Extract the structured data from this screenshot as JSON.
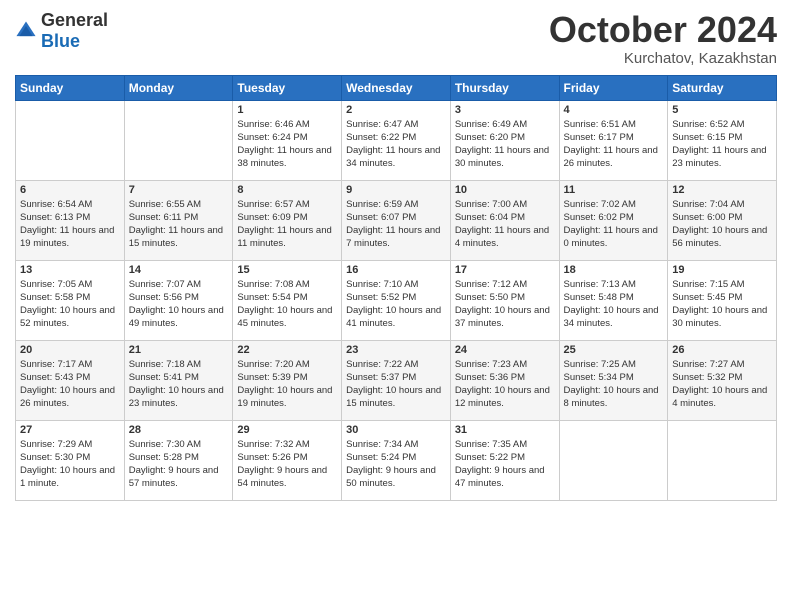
{
  "logo": {
    "general": "General",
    "blue": "Blue"
  },
  "title": {
    "month": "October 2024",
    "location": "Kurchatov, Kazakhstan"
  },
  "headers": [
    "Sunday",
    "Monday",
    "Tuesday",
    "Wednesday",
    "Thursday",
    "Friday",
    "Saturday"
  ],
  "weeks": [
    [
      {
        "day": "",
        "sunrise": "",
        "sunset": "",
        "daylight": ""
      },
      {
        "day": "",
        "sunrise": "",
        "sunset": "",
        "daylight": ""
      },
      {
        "day": "1",
        "sunrise": "Sunrise: 6:46 AM",
        "sunset": "Sunset: 6:24 PM",
        "daylight": "Daylight: 11 hours and 38 minutes."
      },
      {
        "day": "2",
        "sunrise": "Sunrise: 6:47 AM",
        "sunset": "Sunset: 6:22 PM",
        "daylight": "Daylight: 11 hours and 34 minutes."
      },
      {
        "day": "3",
        "sunrise": "Sunrise: 6:49 AM",
        "sunset": "Sunset: 6:20 PM",
        "daylight": "Daylight: 11 hours and 30 minutes."
      },
      {
        "day": "4",
        "sunrise": "Sunrise: 6:51 AM",
        "sunset": "Sunset: 6:17 PM",
        "daylight": "Daylight: 11 hours and 26 minutes."
      },
      {
        "day": "5",
        "sunrise": "Sunrise: 6:52 AM",
        "sunset": "Sunset: 6:15 PM",
        "daylight": "Daylight: 11 hours and 23 minutes."
      }
    ],
    [
      {
        "day": "6",
        "sunrise": "Sunrise: 6:54 AM",
        "sunset": "Sunset: 6:13 PM",
        "daylight": "Daylight: 11 hours and 19 minutes."
      },
      {
        "day": "7",
        "sunrise": "Sunrise: 6:55 AM",
        "sunset": "Sunset: 6:11 PM",
        "daylight": "Daylight: 11 hours and 15 minutes."
      },
      {
        "day": "8",
        "sunrise": "Sunrise: 6:57 AM",
        "sunset": "Sunset: 6:09 PM",
        "daylight": "Daylight: 11 hours and 11 minutes."
      },
      {
        "day": "9",
        "sunrise": "Sunrise: 6:59 AM",
        "sunset": "Sunset: 6:07 PM",
        "daylight": "Daylight: 11 hours and 7 minutes."
      },
      {
        "day": "10",
        "sunrise": "Sunrise: 7:00 AM",
        "sunset": "Sunset: 6:04 PM",
        "daylight": "Daylight: 11 hours and 4 minutes."
      },
      {
        "day": "11",
        "sunrise": "Sunrise: 7:02 AM",
        "sunset": "Sunset: 6:02 PM",
        "daylight": "Daylight: 11 hours and 0 minutes."
      },
      {
        "day": "12",
        "sunrise": "Sunrise: 7:04 AM",
        "sunset": "Sunset: 6:00 PM",
        "daylight": "Daylight: 10 hours and 56 minutes."
      }
    ],
    [
      {
        "day": "13",
        "sunrise": "Sunrise: 7:05 AM",
        "sunset": "Sunset: 5:58 PM",
        "daylight": "Daylight: 10 hours and 52 minutes."
      },
      {
        "day": "14",
        "sunrise": "Sunrise: 7:07 AM",
        "sunset": "Sunset: 5:56 PM",
        "daylight": "Daylight: 10 hours and 49 minutes."
      },
      {
        "day": "15",
        "sunrise": "Sunrise: 7:08 AM",
        "sunset": "Sunset: 5:54 PM",
        "daylight": "Daylight: 10 hours and 45 minutes."
      },
      {
        "day": "16",
        "sunrise": "Sunrise: 7:10 AM",
        "sunset": "Sunset: 5:52 PM",
        "daylight": "Daylight: 10 hours and 41 minutes."
      },
      {
        "day": "17",
        "sunrise": "Sunrise: 7:12 AM",
        "sunset": "Sunset: 5:50 PM",
        "daylight": "Daylight: 10 hours and 37 minutes."
      },
      {
        "day": "18",
        "sunrise": "Sunrise: 7:13 AM",
        "sunset": "Sunset: 5:48 PM",
        "daylight": "Daylight: 10 hours and 34 minutes."
      },
      {
        "day": "19",
        "sunrise": "Sunrise: 7:15 AM",
        "sunset": "Sunset: 5:45 PM",
        "daylight": "Daylight: 10 hours and 30 minutes."
      }
    ],
    [
      {
        "day": "20",
        "sunrise": "Sunrise: 7:17 AM",
        "sunset": "Sunset: 5:43 PM",
        "daylight": "Daylight: 10 hours and 26 minutes."
      },
      {
        "day": "21",
        "sunrise": "Sunrise: 7:18 AM",
        "sunset": "Sunset: 5:41 PM",
        "daylight": "Daylight: 10 hours and 23 minutes."
      },
      {
        "day": "22",
        "sunrise": "Sunrise: 7:20 AM",
        "sunset": "Sunset: 5:39 PM",
        "daylight": "Daylight: 10 hours and 19 minutes."
      },
      {
        "day": "23",
        "sunrise": "Sunrise: 7:22 AM",
        "sunset": "Sunset: 5:37 PM",
        "daylight": "Daylight: 10 hours and 15 minutes."
      },
      {
        "day": "24",
        "sunrise": "Sunrise: 7:23 AM",
        "sunset": "Sunset: 5:36 PM",
        "daylight": "Daylight: 10 hours and 12 minutes."
      },
      {
        "day": "25",
        "sunrise": "Sunrise: 7:25 AM",
        "sunset": "Sunset: 5:34 PM",
        "daylight": "Daylight: 10 hours and 8 minutes."
      },
      {
        "day": "26",
        "sunrise": "Sunrise: 7:27 AM",
        "sunset": "Sunset: 5:32 PM",
        "daylight": "Daylight: 10 hours and 4 minutes."
      }
    ],
    [
      {
        "day": "27",
        "sunrise": "Sunrise: 7:29 AM",
        "sunset": "Sunset: 5:30 PM",
        "daylight": "Daylight: 10 hours and 1 minute."
      },
      {
        "day": "28",
        "sunrise": "Sunrise: 7:30 AM",
        "sunset": "Sunset: 5:28 PM",
        "daylight": "Daylight: 9 hours and 57 minutes."
      },
      {
        "day": "29",
        "sunrise": "Sunrise: 7:32 AM",
        "sunset": "Sunset: 5:26 PM",
        "daylight": "Daylight: 9 hours and 54 minutes."
      },
      {
        "day": "30",
        "sunrise": "Sunrise: 7:34 AM",
        "sunset": "Sunset: 5:24 PM",
        "daylight": "Daylight: 9 hours and 50 minutes."
      },
      {
        "day": "31",
        "sunrise": "Sunrise: 7:35 AM",
        "sunset": "Sunset: 5:22 PM",
        "daylight": "Daylight: 9 hours and 47 minutes."
      },
      {
        "day": "",
        "sunrise": "",
        "sunset": "",
        "daylight": ""
      },
      {
        "day": "",
        "sunrise": "",
        "sunset": "",
        "daylight": ""
      }
    ]
  ]
}
